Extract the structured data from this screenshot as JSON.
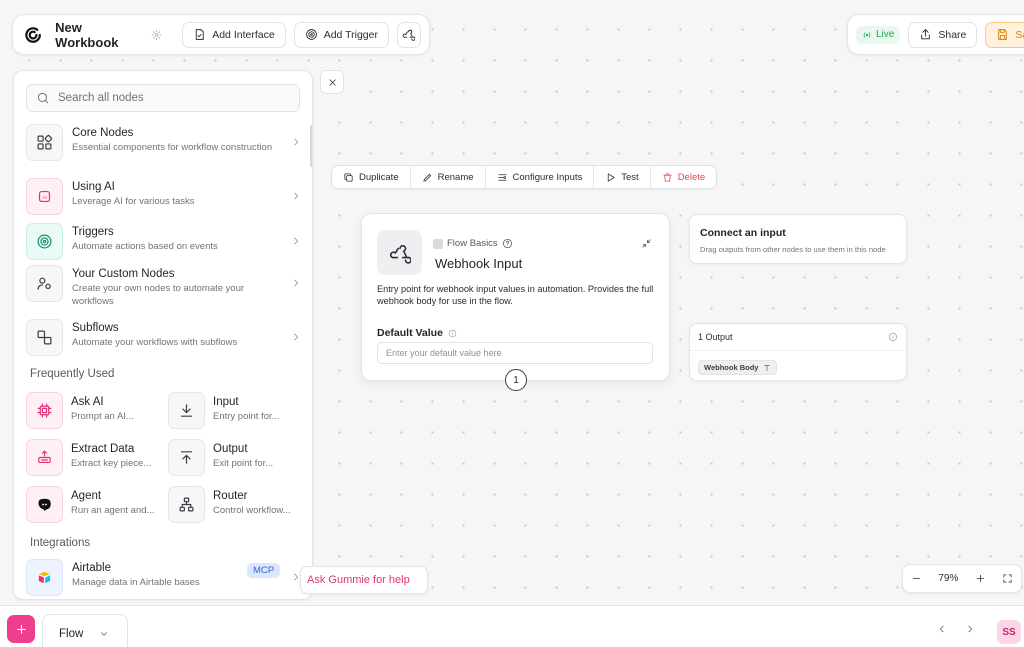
{
  "header": {
    "workbook_title": "New Workbook",
    "add_interface": "Add Interface",
    "add_trigger": "Add Trigger",
    "live": "Live",
    "share": "Share",
    "save": "Save"
  },
  "panel": {
    "search_placeholder": "Search all nodes",
    "categories": [
      {
        "name": "Core Nodes",
        "desc": "Essential components for workflow construction",
        "icon": "grid-icon"
      },
      {
        "name": "Using AI",
        "desc": "Leverage AI for various tasks",
        "icon": "ai-icon"
      },
      {
        "name": "Triggers",
        "desc": "Automate actions based on events",
        "icon": "fingerprint-icon"
      },
      {
        "name": "Your Custom Nodes",
        "desc": "Create your own nodes to automate your workflows",
        "icon": "user-nodes-icon"
      },
      {
        "name": "Subflows",
        "desc": "Automate your workflows with subflows",
        "icon": "subflow-icon"
      }
    ],
    "frequently_used_heading": "Frequently Used",
    "frequent": [
      {
        "name": "Ask AI",
        "desc": "Prompt an AI...",
        "icon": "chip-icon"
      },
      {
        "name": "Input",
        "desc": "Entry point for...",
        "icon": "download-icon"
      },
      {
        "name": "Extract Data",
        "desc": "Extract key piece...",
        "icon": "extract-icon"
      },
      {
        "name": "Output",
        "desc": "Exit point for...",
        "icon": "upload-icon"
      },
      {
        "name": "Agent",
        "desc": "Run an agent and...",
        "icon": "agent-icon"
      },
      {
        "name": "Router",
        "desc": "Control workflow...",
        "icon": "router-icon"
      }
    ],
    "integrations_heading": "Integrations",
    "integrations": [
      {
        "name": "Airtable",
        "desc": "Manage data in Airtable bases",
        "badge": "MCP",
        "icon": "airtable-icon"
      }
    ]
  },
  "toolbar": {
    "duplicate": "Duplicate",
    "rename": "Rename",
    "configure_inputs": "Configure Inputs",
    "test": "Test",
    "delete": "Delete"
  },
  "node": {
    "category": "Flow Basics",
    "title": "Webhook Input",
    "description": "Entry point for webhook input values in automation. Provides the full webhook body for use in the flow.",
    "field_label": "Default Value",
    "field_placeholder": "Enter your default value here",
    "port_number": "1"
  },
  "connect_card": {
    "title": "Connect an input",
    "desc": "Drag outputs from other nodes to use them in this node"
  },
  "output_card": {
    "title": "1 Output",
    "chip": "Webhook Body"
  },
  "ask_gummie": "Ask Gummie for help",
  "zoom": {
    "level": "79%"
  },
  "bottom": {
    "tab_label": "Flow",
    "avatar": "SS"
  },
  "colors": {
    "accent_pink": "#ef3f8c",
    "live_green": "#22a355",
    "save_orange": "#d97a06",
    "delete_red": "#e04848"
  }
}
